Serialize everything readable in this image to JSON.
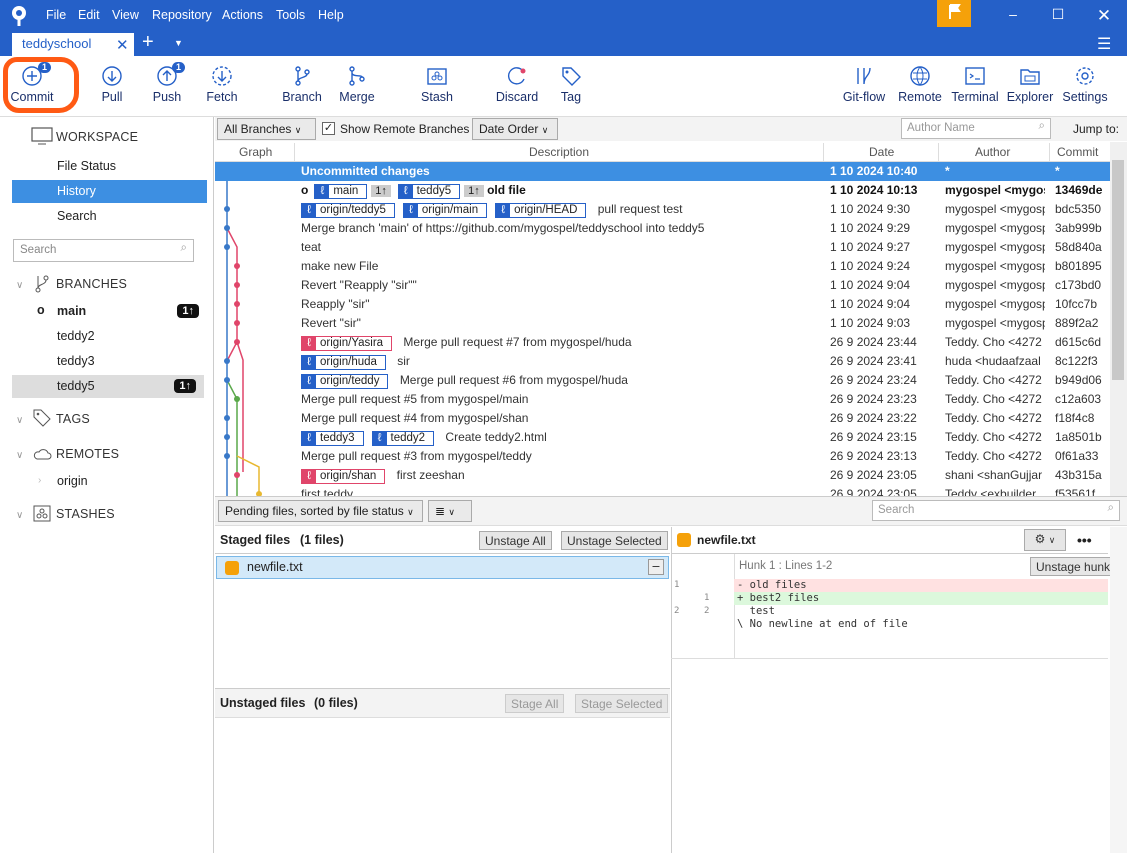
{
  "menu": [
    "File",
    "Edit",
    "View",
    "Repository",
    "Actions",
    "Tools",
    "Help"
  ],
  "tab": {
    "name": "teddyschool"
  },
  "toolbar": {
    "commit": "Commit",
    "commit_badge": "1",
    "pull": "Pull",
    "push": "Push",
    "push_badge": "1",
    "fetch": "Fetch",
    "branch": "Branch",
    "merge": "Merge",
    "stash": "Stash",
    "discard": "Discard",
    "tag": "Tag",
    "gitflow": "Git-flow",
    "remote": "Remote",
    "terminal": "Terminal",
    "explorer": "Explorer",
    "settings": "Settings"
  },
  "sidebar": {
    "workspace": "WORKSPACE",
    "file_status": "File Status",
    "history": "History",
    "search": "Search",
    "search_placeholder": "Search",
    "branches": "BRANCHES",
    "branch_items": [
      {
        "name": "main",
        "count": "1↑"
      },
      {
        "name": "teddy2"
      },
      {
        "name": "teddy3"
      },
      {
        "name": "teddy5",
        "count": "1↑"
      }
    ],
    "tags": "TAGS",
    "remotes": "REMOTES",
    "origin": "origin",
    "stashes": "STASHES"
  },
  "filter": {
    "branches": "All Branches",
    "show_remote": "Show Remote Branches",
    "order": "Date Order",
    "author_placeholder": "Author Name",
    "jump": "Jump to:"
  },
  "columns": {
    "graph": "Graph",
    "description": "Description",
    "date": "Date",
    "author": "Author",
    "commit": "Commit"
  },
  "commits": [
    {
      "desc": "Uncommitted changes",
      "date": "1 10 2024 10:40",
      "author": "*",
      "hash": "*"
    },
    {
      "desc": "old file",
      "date": "1 10 2024 10:13",
      "author": "mygospel <mygospel",
      "hash": "13469de"
    },
    {
      "desc": "pull request test",
      "date": "1 10 2024 9:30",
      "author": "mygospel <mygospel",
      "hash": "bdc5350"
    },
    {
      "desc": "Merge branch 'main' of https://github.com/mygospel/teddyschool into teddy5",
      "date": "1 10 2024 9:29",
      "author": "mygospel <mygospel",
      "hash": "3ab999b"
    },
    {
      "desc": "teat",
      "date": "1 10 2024 9:27",
      "author": "mygospel <mygospel",
      "hash": "58d840a"
    },
    {
      "desc": "make new File",
      "date": "1 10 2024 9:24",
      "author": "mygospel <mygospel",
      "hash": "b801895"
    },
    {
      "desc": "Revert \"Reapply \"sir\"\"",
      "date": "1 10 2024 9:04",
      "author": "mygospel <mygospel",
      "hash": "c173bd0"
    },
    {
      "desc": "Reapply \"sir\"",
      "date": "1 10 2024 9:04",
      "author": "mygospel <mygospel",
      "hash": "10fcc7b"
    },
    {
      "desc": "Revert \"sir\"",
      "date": "1 10 2024 9:03",
      "author": "mygospel <mygospel",
      "hash": "889f2a2"
    },
    {
      "desc": "Merge pull request #7 from mygospel/huda",
      "date": "26 9 2024 23:44",
      "author": "Teddy. Cho <4272",
      "hash": "d615c6d"
    },
    {
      "desc": "sir",
      "date": "26 9 2024 23:41",
      "author": "huda <hudaafzaal",
      "hash": "8c122f3"
    },
    {
      "desc": "Merge pull request #6 from mygospel/huda",
      "date": "26 9 2024 23:24",
      "author": "Teddy. Cho <4272",
      "hash": "b949d06"
    },
    {
      "desc": "Merge pull request #5 from mygospel/main",
      "date": "26 9 2024 23:23",
      "author": "Teddy. Cho <4272",
      "hash": "c12a603"
    },
    {
      "desc": "Merge pull request #4 from mygospel/shan",
      "date": "26 9 2024 23:22",
      "author": "Teddy. Cho <4272",
      "hash": "f18f4c8"
    },
    {
      "desc": "Create teddy2.html",
      "date": "26 9 2024 23:15",
      "author": "Teddy. Cho <4272",
      "hash": "1a8501b"
    },
    {
      "desc": "Merge pull request #3 from mygospel/teddy",
      "date": "26 9 2024 23:13",
      "author": "Teddy. Cho <4272",
      "hash": "0f61a33"
    },
    {
      "desc": "first zeeshan",
      "date": "26 9 2024 23:05",
      "author": "shani <shanGujjar",
      "hash": "43b315a"
    },
    {
      "desc": "first teddy",
      "date": "26 9 2024 23:05",
      "author": "Teddy <exbuilder",
      "hash": "f53561f"
    }
  ],
  "refs": {
    "main": "main",
    "main_ahead": "1↑",
    "teddy5": "teddy5",
    "teddy5_ahead": "1↑",
    "origin_teddy5": "origin/teddy5",
    "origin_main": "origin/main",
    "origin_head": "origin/HEAD",
    "origin_yasira": "origin/Yasira",
    "origin_huda": "origin/huda",
    "origin_teddy": "origin/teddy",
    "teddy3": "teddy3",
    "teddy2": "teddy2",
    "origin_shan": "origin/shan"
  },
  "lower": {
    "pending": "Pending files, sorted by file status",
    "search_placeholder": "Search",
    "staged_title": "Staged files",
    "staged_count": "(1 files)",
    "unstage_all": "Unstage All",
    "unstage_selected": "Unstage Selected",
    "staged_file": "newfile.txt",
    "unstaged_title": "Unstaged files",
    "unstaged_count": "(0 files)",
    "stage_all": "Stage All",
    "stage_selected": "Stage Selected"
  },
  "diff": {
    "file": "newfile.txt",
    "hunk": "Hunk 1 : Lines 1-2",
    "unstage_hunk": "Unstage hunk",
    "lines": [
      {
        "old": "1",
        "new": "",
        "text": "- old files",
        "type": "del"
      },
      {
        "old": "",
        "new": "1",
        "text": "+ best2 files",
        "type": "add"
      },
      {
        "old": "2",
        "new": "2",
        "text": "  test",
        "type": "ctx"
      },
      {
        "old": "",
        "new": "",
        "text": "\\ No newline at end of file",
        "type": "ctx"
      }
    ]
  },
  "colors": {
    "titlebar": "#2560c8",
    "accent": "#3d8fe2",
    "highlight": "#ff5a14",
    "flag": "#f5a10a"
  }
}
